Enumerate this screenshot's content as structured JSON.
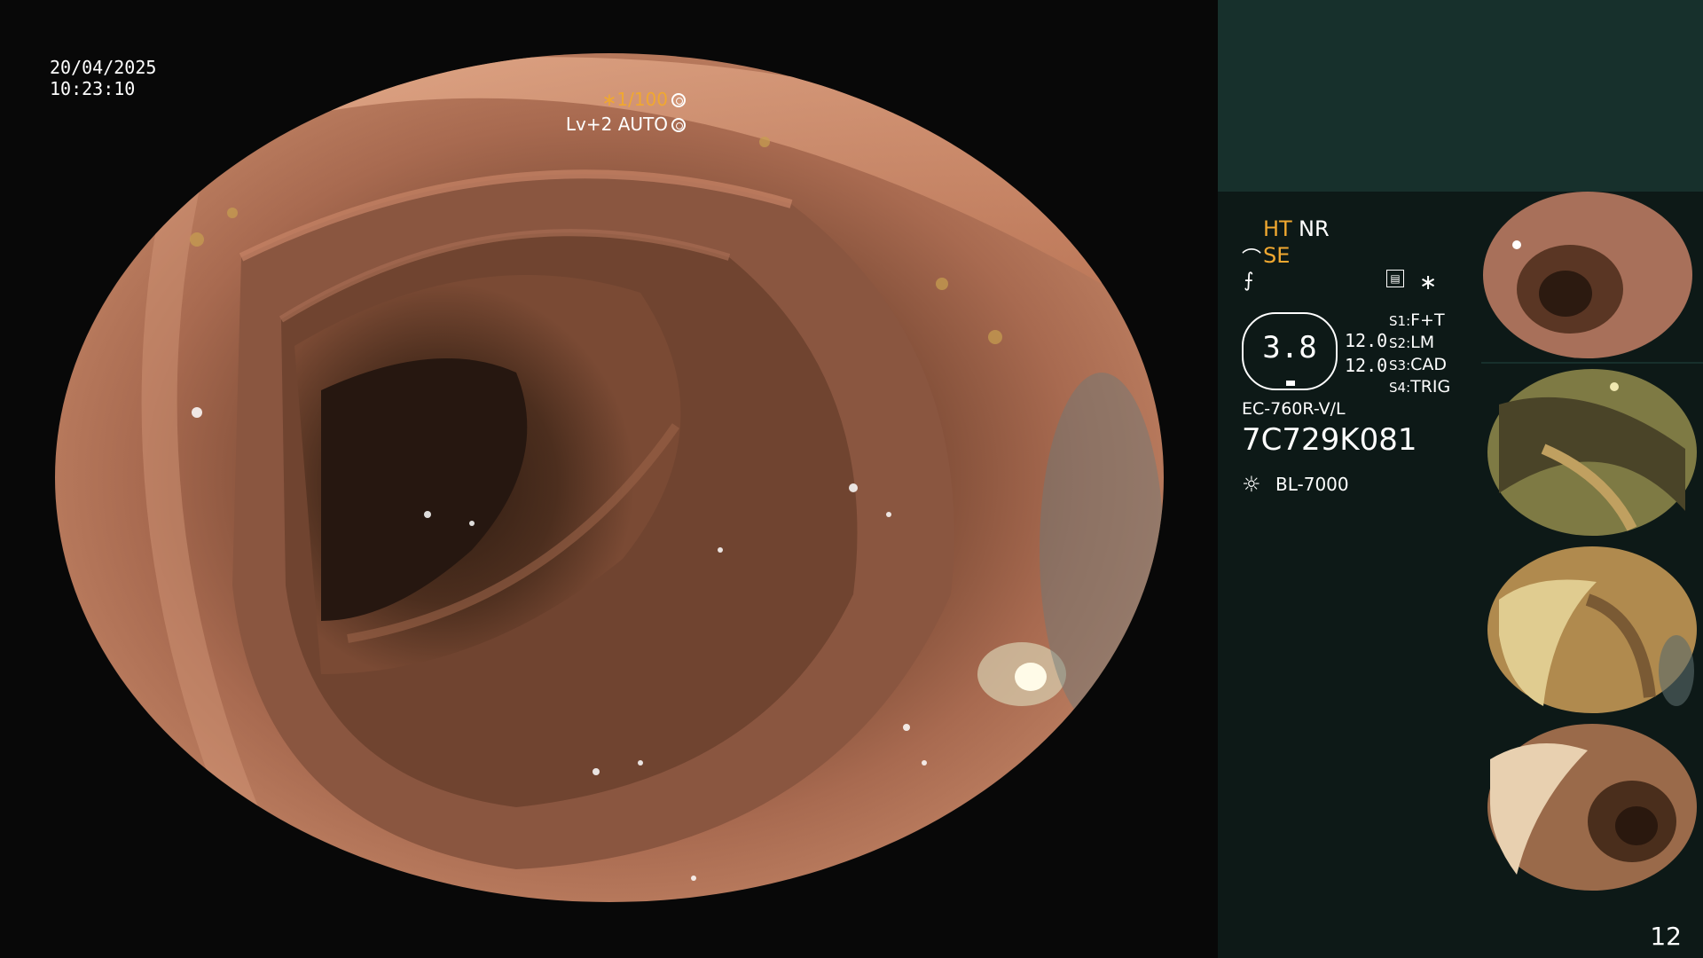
{
  "overlay": {
    "date": "20/04/2025",
    "time": "10:23:10",
    "shutter": "∗1/100",
    "light_level": "Lv+2 AUTO"
  },
  "panel": {
    "ht": "HT",
    "nr": "NR",
    "se": "SE",
    "gauge_value": "3.8",
    "val1": "12.0",
    "val2": "12.0",
    "switches": [
      {
        "key": "S1:",
        "value": "F+T"
      },
      {
        "key": "S2:",
        "value": "LM"
      },
      {
        "key": "S3:",
        "value": "CAD"
      },
      {
        "key": "S4:",
        "value": "TRIG"
      }
    ],
    "scope_model": "EC-760R-V/L",
    "serial": "7C729K081",
    "light_source": "BL-7000",
    "asterisk": "∗"
  },
  "thumbnails": [
    {
      "tint": "#b07a64"
    },
    {
      "tint": "#8a8c54"
    },
    {
      "tint": "#b38a52"
    },
    {
      "tint": "#9a6a4a"
    }
  ],
  "page_number": "12",
  "colors": {
    "accent": "#f0a830",
    "panel_bg": "#0d1917",
    "panel_header": "#17302c"
  }
}
